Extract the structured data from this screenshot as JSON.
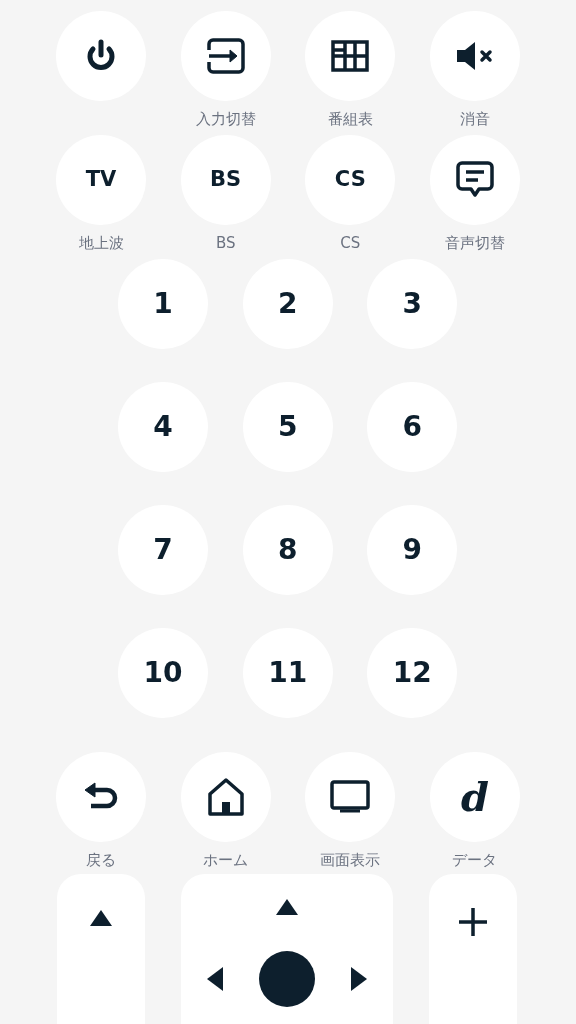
{
  "function_rows": [
    [
      {
        "kind": "icon"
      },
      {
        "kind": "icon",
        "label": "入力切替"
      },
      {
        "kind": "icon",
        "label": "番組表"
      },
      {
        "kind": "icon",
        "label": "消音"
      }
    ],
    [
      {
        "kind": "text",
        "text": "TV",
        "label": "地上波"
      },
      {
        "kind": "text",
        "text": "BS",
        "label": "BS"
      },
      {
        "kind": "text",
        "text": "CS",
        "label": "CS"
      },
      {
        "kind": "icon",
        "label": "音声切替"
      }
    ]
  ],
  "number_pad": [
    "1",
    "2",
    "3",
    "4",
    "5",
    "6",
    "7",
    "8",
    "9",
    "10",
    "11",
    "12"
  ],
  "nav_row": [
    {
      "kind": "icon",
      "label": "戻る"
    },
    {
      "kind": "icon",
      "label": "ホーム"
    },
    {
      "kind": "icon",
      "label": "画面表示"
    },
    {
      "kind": "logo",
      "text": "d",
      "label": "データ"
    }
  ]
}
